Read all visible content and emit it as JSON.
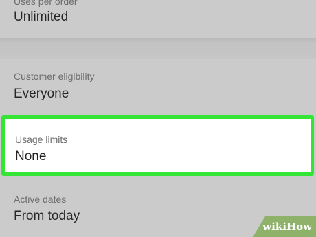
{
  "uses_per_order": {
    "label": "Uses per order",
    "value": "Unlimited"
  },
  "customer_eligibility": {
    "label": "Customer eligibility",
    "value": "Everyone"
  },
  "usage_limits": {
    "label": "Usage limits",
    "value": "None",
    "highlight_color": "#35e535"
  },
  "active_dates": {
    "label": "Active dates",
    "value": "From today"
  },
  "watermark": {
    "text": "wikiHow",
    "color": "#8fb26b"
  }
}
